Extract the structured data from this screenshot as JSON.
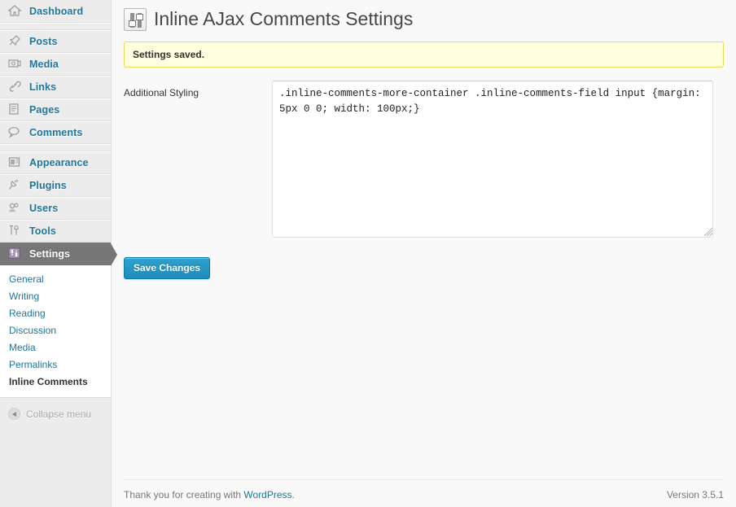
{
  "sidebar": {
    "items": [
      {
        "label": "Dashboard",
        "icon": "dashboard-home-icon",
        "sep_after": true,
        "current": false
      },
      {
        "label": "Posts",
        "icon": "pin-icon",
        "sep_after": false,
        "current": false
      },
      {
        "label": "Media",
        "icon": "camera-icon",
        "sep_after": false,
        "current": false
      },
      {
        "label": "Links",
        "icon": "link-icon",
        "sep_after": false,
        "current": false
      },
      {
        "label": "Pages",
        "icon": "page-icon",
        "sep_after": false,
        "current": false
      },
      {
        "label": "Comments",
        "icon": "comment-bubble-icon",
        "sep_after": true,
        "current": false
      },
      {
        "label": "Appearance",
        "icon": "appearance-icon",
        "sep_after": false,
        "current": false
      },
      {
        "label": "Plugins",
        "icon": "plug-icon",
        "sep_after": false,
        "current": false
      },
      {
        "label": "Users",
        "icon": "users-icon",
        "sep_after": false,
        "current": false
      },
      {
        "label": "Tools",
        "icon": "tools-icon",
        "sep_after": false,
        "current": false
      },
      {
        "label": "Settings",
        "icon": "settings-sliders-icon",
        "sep_after": false,
        "current": true
      }
    ],
    "submenu": [
      {
        "label": "General",
        "current": false
      },
      {
        "label": "Writing",
        "current": false
      },
      {
        "label": "Reading",
        "current": false
      },
      {
        "label": "Discussion",
        "current": false
      },
      {
        "label": "Media",
        "current": false
      },
      {
        "label": "Permalinks",
        "current": false
      },
      {
        "label": "Inline Comments",
        "current": true
      }
    ],
    "collapse_label": "Collapse menu"
  },
  "header": {
    "icon": "settings-sliders-icon",
    "title": "Inline AJax Comments Settings"
  },
  "notice": {
    "text": "Settings saved.",
    "bg": "#ffffe0",
    "border": "#e6db55"
  },
  "form": {
    "styling_label": "Additional Styling",
    "styling_value": ".inline-comments-more-container .inline-comments-field input {margin: 5px 0 0; width: 100px;}",
    "styling_placeholder": "",
    "save_label": "Save Changes"
  },
  "footer": {
    "thanks_prefix": "Thank you for creating with ",
    "wordpress_link": "WordPress",
    "thanks_suffix": ".",
    "version": "Version 3.5.1"
  },
  "colors": {
    "accent_link": "#21759b",
    "button_blue": "#1e8cbe",
    "sidebar_bg": "#ececec",
    "current_menu_bg": "#777777"
  }
}
